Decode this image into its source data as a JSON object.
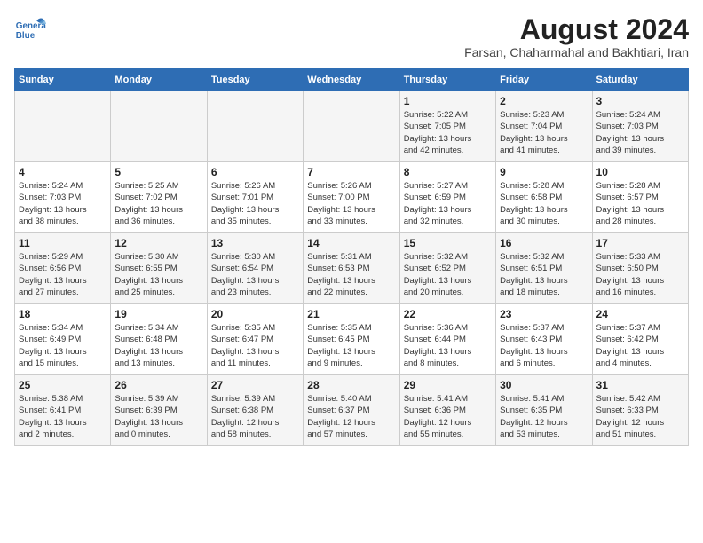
{
  "header": {
    "logo_line1": "General",
    "logo_line2": "Blue",
    "month_year": "August 2024",
    "location": "Farsan, Chaharmahal and Bakhtiari, Iran"
  },
  "weekdays": [
    "Sunday",
    "Monday",
    "Tuesday",
    "Wednesday",
    "Thursday",
    "Friday",
    "Saturday"
  ],
  "weeks": [
    [
      {
        "day": "",
        "info": ""
      },
      {
        "day": "",
        "info": ""
      },
      {
        "day": "",
        "info": ""
      },
      {
        "day": "",
        "info": ""
      },
      {
        "day": "1",
        "info": "Sunrise: 5:22 AM\nSunset: 7:05 PM\nDaylight: 13 hours\nand 42 minutes."
      },
      {
        "day": "2",
        "info": "Sunrise: 5:23 AM\nSunset: 7:04 PM\nDaylight: 13 hours\nand 41 minutes."
      },
      {
        "day": "3",
        "info": "Sunrise: 5:24 AM\nSunset: 7:03 PM\nDaylight: 13 hours\nand 39 minutes."
      }
    ],
    [
      {
        "day": "4",
        "info": "Sunrise: 5:24 AM\nSunset: 7:03 PM\nDaylight: 13 hours\nand 38 minutes."
      },
      {
        "day": "5",
        "info": "Sunrise: 5:25 AM\nSunset: 7:02 PM\nDaylight: 13 hours\nand 36 minutes."
      },
      {
        "day": "6",
        "info": "Sunrise: 5:26 AM\nSunset: 7:01 PM\nDaylight: 13 hours\nand 35 minutes."
      },
      {
        "day": "7",
        "info": "Sunrise: 5:26 AM\nSunset: 7:00 PM\nDaylight: 13 hours\nand 33 minutes."
      },
      {
        "day": "8",
        "info": "Sunrise: 5:27 AM\nSunset: 6:59 PM\nDaylight: 13 hours\nand 32 minutes."
      },
      {
        "day": "9",
        "info": "Sunrise: 5:28 AM\nSunset: 6:58 PM\nDaylight: 13 hours\nand 30 minutes."
      },
      {
        "day": "10",
        "info": "Sunrise: 5:28 AM\nSunset: 6:57 PM\nDaylight: 13 hours\nand 28 minutes."
      }
    ],
    [
      {
        "day": "11",
        "info": "Sunrise: 5:29 AM\nSunset: 6:56 PM\nDaylight: 13 hours\nand 27 minutes."
      },
      {
        "day": "12",
        "info": "Sunrise: 5:30 AM\nSunset: 6:55 PM\nDaylight: 13 hours\nand 25 minutes."
      },
      {
        "day": "13",
        "info": "Sunrise: 5:30 AM\nSunset: 6:54 PM\nDaylight: 13 hours\nand 23 minutes."
      },
      {
        "day": "14",
        "info": "Sunrise: 5:31 AM\nSunset: 6:53 PM\nDaylight: 13 hours\nand 22 minutes."
      },
      {
        "day": "15",
        "info": "Sunrise: 5:32 AM\nSunset: 6:52 PM\nDaylight: 13 hours\nand 20 minutes."
      },
      {
        "day": "16",
        "info": "Sunrise: 5:32 AM\nSunset: 6:51 PM\nDaylight: 13 hours\nand 18 minutes."
      },
      {
        "day": "17",
        "info": "Sunrise: 5:33 AM\nSunset: 6:50 PM\nDaylight: 13 hours\nand 16 minutes."
      }
    ],
    [
      {
        "day": "18",
        "info": "Sunrise: 5:34 AM\nSunset: 6:49 PM\nDaylight: 13 hours\nand 15 minutes."
      },
      {
        "day": "19",
        "info": "Sunrise: 5:34 AM\nSunset: 6:48 PM\nDaylight: 13 hours\nand 13 minutes."
      },
      {
        "day": "20",
        "info": "Sunrise: 5:35 AM\nSunset: 6:47 PM\nDaylight: 13 hours\nand 11 minutes."
      },
      {
        "day": "21",
        "info": "Sunrise: 5:35 AM\nSunset: 6:45 PM\nDaylight: 13 hours\nand 9 minutes."
      },
      {
        "day": "22",
        "info": "Sunrise: 5:36 AM\nSunset: 6:44 PM\nDaylight: 13 hours\nand 8 minutes."
      },
      {
        "day": "23",
        "info": "Sunrise: 5:37 AM\nSunset: 6:43 PM\nDaylight: 13 hours\nand 6 minutes."
      },
      {
        "day": "24",
        "info": "Sunrise: 5:37 AM\nSunset: 6:42 PM\nDaylight: 13 hours\nand 4 minutes."
      }
    ],
    [
      {
        "day": "25",
        "info": "Sunrise: 5:38 AM\nSunset: 6:41 PM\nDaylight: 13 hours\nand 2 minutes."
      },
      {
        "day": "26",
        "info": "Sunrise: 5:39 AM\nSunset: 6:39 PM\nDaylight: 13 hours\nand 0 minutes."
      },
      {
        "day": "27",
        "info": "Sunrise: 5:39 AM\nSunset: 6:38 PM\nDaylight: 12 hours\nand 58 minutes."
      },
      {
        "day": "28",
        "info": "Sunrise: 5:40 AM\nSunset: 6:37 PM\nDaylight: 12 hours\nand 57 minutes."
      },
      {
        "day": "29",
        "info": "Sunrise: 5:41 AM\nSunset: 6:36 PM\nDaylight: 12 hours\nand 55 minutes."
      },
      {
        "day": "30",
        "info": "Sunrise: 5:41 AM\nSunset: 6:35 PM\nDaylight: 12 hours\nand 53 minutes."
      },
      {
        "day": "31",
        "info": "Sunrise: 5:42 AM\nSunset: 6:33 PM\nDaylight: 12 hours\nand 51 minutes."
      }
    ]
  ]
}
